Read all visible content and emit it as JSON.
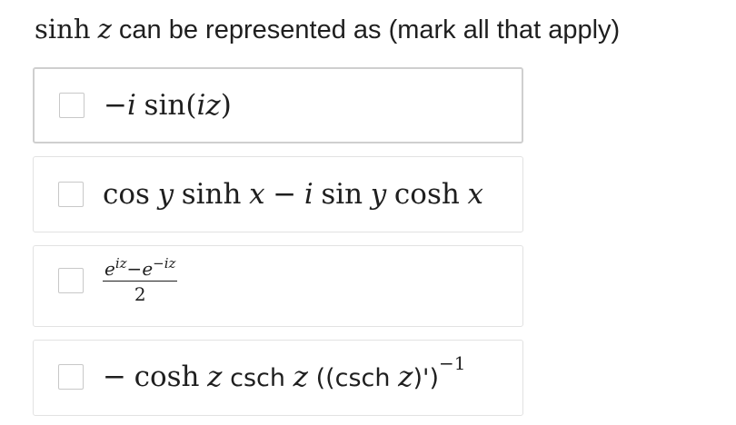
{
  "question": {
    "func": "sinh",
    "var": "z",
    "text": "can be represented as (mark all that apply)"
  },
  "options": [
    {
      "id": "A",
      "minus": "−",
      "i": "i",
      "func": "sin",
      "lparen": "(",
      "arg": "iz",
      "rparen": ")"
    },
    {
      "id": "B",
      "cos": "cos",
      "y1": "y",
      "sinh": "sinh",
      "x1": "x",
      "minus": "−",
      "i": "i",
      "sin": "sin",
      "y2": "y",
      "cosh": "cosh",
      "x2": "x"
    },
    {
      "id": "C",
      "e1": "e",
      "exp1": "iz",
      "minus": "−",
      "e2": "e",
      "exp2": "−iz",
      "den": "2"
    },
    {
      "id": "D",
      "minus": "−",
      "cosh": "cosh",
      "z1": "z",
      "csch1": "csch",
      "z2": "z",
      "open": "((csch",
      "z3": "z",
      "close": ")')",
      "exp": "−1"
    }
  ]
}
